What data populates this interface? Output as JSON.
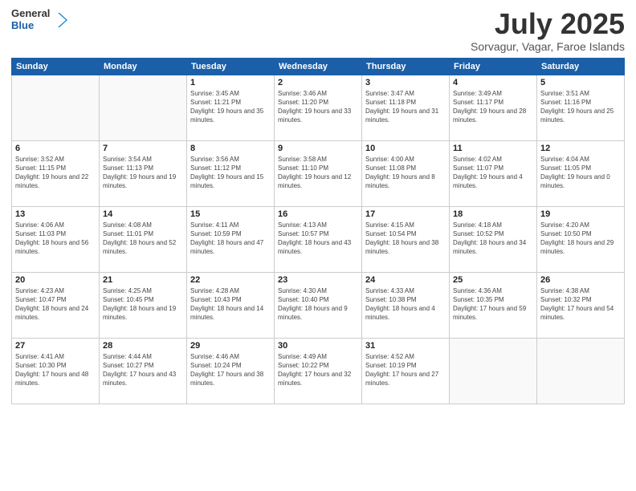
{
  "logo": {
    "general": "General",
    "blue": "Blue"
  },
  "header": {
    "title": "July 2025",
    "subtitle": "Sorvagur, Vagar, Faroe Islands"
  },
  "weekdays": [
    "Sunday",
    "Monday",
    "Tuesday",
    "Wednesday",
    "Thursday",
    "Friday",
    "Saturday"
  ],
  "weeks": [
    [
      {
        "day": "",
        "sunrise": "",
        "sunset": "",
        "daylight": ""
      },
      {
        "day": "",
        "sunrise": "",
        "sunset": "",
        "daylight": ""
      },
      {
        "day": "1",
        "sunrise": "Sunrise: 3:45 AM",
        "sunset": "Sunset: 11:21 PM",
        "daylight": "Daylight: 19 hours and 35 minutes."
      },
      {
        "day": "2",
        "sunrise": "Sunrise: 3:46 AM",
        "sunset": "Sunset: 11:20 PM",
        "daylight": "Daylight: 19 hours and 33 minutes."
      },
      {
        "day": "3",
        "sunrise": "Sunrise: 3:47 AM",
        "sunset": "Sunset: 11:18 PM",
        "daylight": "Daylight: 19 hours and 31 minutes."
      },
      {
        "day": "4",
        "sunrise": "Sunrise: 3:49 AM",
        "sunset": "Sunset: 11:17 PM",
        "daylight": "Daylight: 19 hours and 28 minutes."
      },
      {
        "day": "5",
        "sunrise": "Sunrise: 3:51 AM",
        "sunset": "Sunset: 11:16 PM",
        "daylight": "Daylight: 19 hours and 25 minutes."
      }
    ],
    [
      {
        "day": "6",
        "sunrise": "Sunrise: 3:52 AM",
        "sunset": "Sunset: 11:15 PM",
        "daylight": "Daylight: 19 hours and 22 minutes."
      },
      {
        "day": "7",
        "sunrise": "Sunrise: 3:54 AM",
        "sunset": "Sunset: 11:13 PM",
        "daylight": "Daylight: 19 hours and 19 minutes."
      },
      {
        "day": "8",
        "sunrise": "Sunrise: 3:56 AM",
        "sunset": "Sunset: 11:12 PM",
        "daylight": "Daylight: 19 hours and 15 minutes."
      },
      {
        "day": "9",
        "sunrise": "Sunrise: 3:58 AM",
        "sunset": "Sunset: 11:10 PM",
        "daylight": "Daylight: 19 hours and 12 minutes."
      },
      {
        "day": "10",
        "sunrise": "Sunrise: 4:00 AM",
        "sunset": "Sunset: 11:08 PM",
        "daylight": "Daylight: 19 hours and 8 minutes."
      },
      {
        "day": "11",
        "sunrise": "Sunrise: 4:02 AM",
        "sunset": "Sunset: 11:07 PM",
        "daylight": "Daylight: 19 hours and 4 minutes."
      },
      {
        "day": "12",
        "sunrise": "Sunrise: 4:04 AM",
        "sunset": "Sunset: 11:05 PM",
        "daylight": "Daylight: 19 hours and 0 minutes."
      }
    ],
    [
      {
        "day": "13",
        "sunrise": "Sunrise: 4:06 AM",
        "sunset": "Sunset: 11:03 PM",
        "daylight": "Daylight: 18 hours and 56 minutes."
      },
      {
        "day": "14",
        "sunrise": "Sunrise: 4:08 AM",
        "sunset": "Sunset: 11:01 PM",
        "daylight": "Daylight: 18 hours and 52 minutes."
      },
      {
        "day": "15",
        "sunrise": "Sunrise: 4:11 AM",
        "sunset": "Sunset: 10:59 PM",
        "daylight": "Daylight: 18 hours and 47 minutes."
      },
      {
        "day": "16",
        "sunrise": "Sunrise: 4:13 AM",
        "sunset": "Sunset: 10:57 PM",
        "daylight": "Daylight: 18 hours and 43 minutes."
      },
      {
        "day": "17",
        "sunrise": "Sunrise: 4:15 AM",
        "sunset": "Sunset: 10:54 PM",
        "daylight": "Daylight: 18 hours and 38 minutes."
      },
      {
        "day": "18",
        "sunrise": "Sunrise: 4:18 AM",
        "sunset": "Sunset: 10:52 PM",
        "daylight": "Daylight: 18 hours and 34 minutes."
      },
      {
        "day": "19",
        "sunrise": "Sunrise: 4:20 AM",
        "sunset": "Sunset: 10:50 PM",
        "daylight": "Daylight: 18 hours and 29 minutes."
      }
    ],
    [
      {
        "day": "20",
        "sunrise": "Sunrise: 4:23 AM",
        "sunset": "Sunset: 10:47 PM",
        "daylight": "Daylight: 18 hours and 24 minutes."
      },
      {
        "day": "21",
        "sunrise": "Sunrise: 4:25 AM",
        "sunset": "Sunset: 10:45 PM",
        "daylight": "Daylight: 18 hours and 19 minutes."
      },
      {
        "day": "22",
        "sunrise": "Sunrise: 4:28 AM",
        "sunset": "Sunset: 10:43 PM",
        "daylight": "Daylight: 18 hours and 14 minutes."
      },
      {
        "day": "23",
        "sunrise": "Sunrise: 4:30 AM",
        "sunset": "Sunset: 10:40 PM",
        "daylight": "Daylight: 18 hours and 9 minutes."
      },
      {
        "day": "24",
        "sunrise": "Sunrise: 4:33 AM",
        "sunset": "Sunset: 10:38 PM",
        "daylight": "Daylight: 18 hours and 4 minutes."
      },
      {
        "day": "25",
        "sunrise": "Sunrise: 4:36 AM",
        "sunset": "Sunset: 10:35 PM",
        "daylight": "Daylight: 17 hours and 59 minutes."
      },
      {
        "day": "26",
        "sunrise": "Sunrise: 4:38 AM",
        "sunset": "Sunset: 10:32 PM",
        "daylight": "Daylight: 17 hours and 54 minutes."
      }
    ],
    [
      {
        "day": "27",
        "sunrise": "Sunrise: 4:41 AM",
        "sunset": "Sunset: 10:30 PM",
        "daylight": "Daylight: 17 hours and 48 minutes."
      },
      {
        "day": "28",
        "sunrise": "Sunrise: 4:44 AM",
        "sunset": "Sunset: 10:27 PM",
        "daylight": "Daylight: 17 hours and 43 minutes."
      },
      {
        "day": "29",
        "sunrise": "Sunrise: 4:46 AM",
        "sunset": "Sunset: 10:24 PM",
        "daylight": "Daylight: 17 hours and 38 minutes."
      },
      {
        "day": "30",
        "sunrise": "Sunrise: 4:49 AM",
        "sunset": "Sunset: 10:22 PM",
        "daylight": "Daylight: 17 hours and 32 minutes."
      },
      {
        "day": "31",
        "sunrise": "Sunrise: 4:52 AM",
        "sunset": "Sunset: 10:19 PM",
        "daylight": "Daylight: 17 hours and 27 minutes."
      },
      {
        "day": "",
        "sunrise": "",
        "sunset": "",
        "daylight": ""
      },
      {
        "day": "",
        "sunrise": "",
        "sunset": "",
        "daylight": ""
      }
    ]
  ]
}
